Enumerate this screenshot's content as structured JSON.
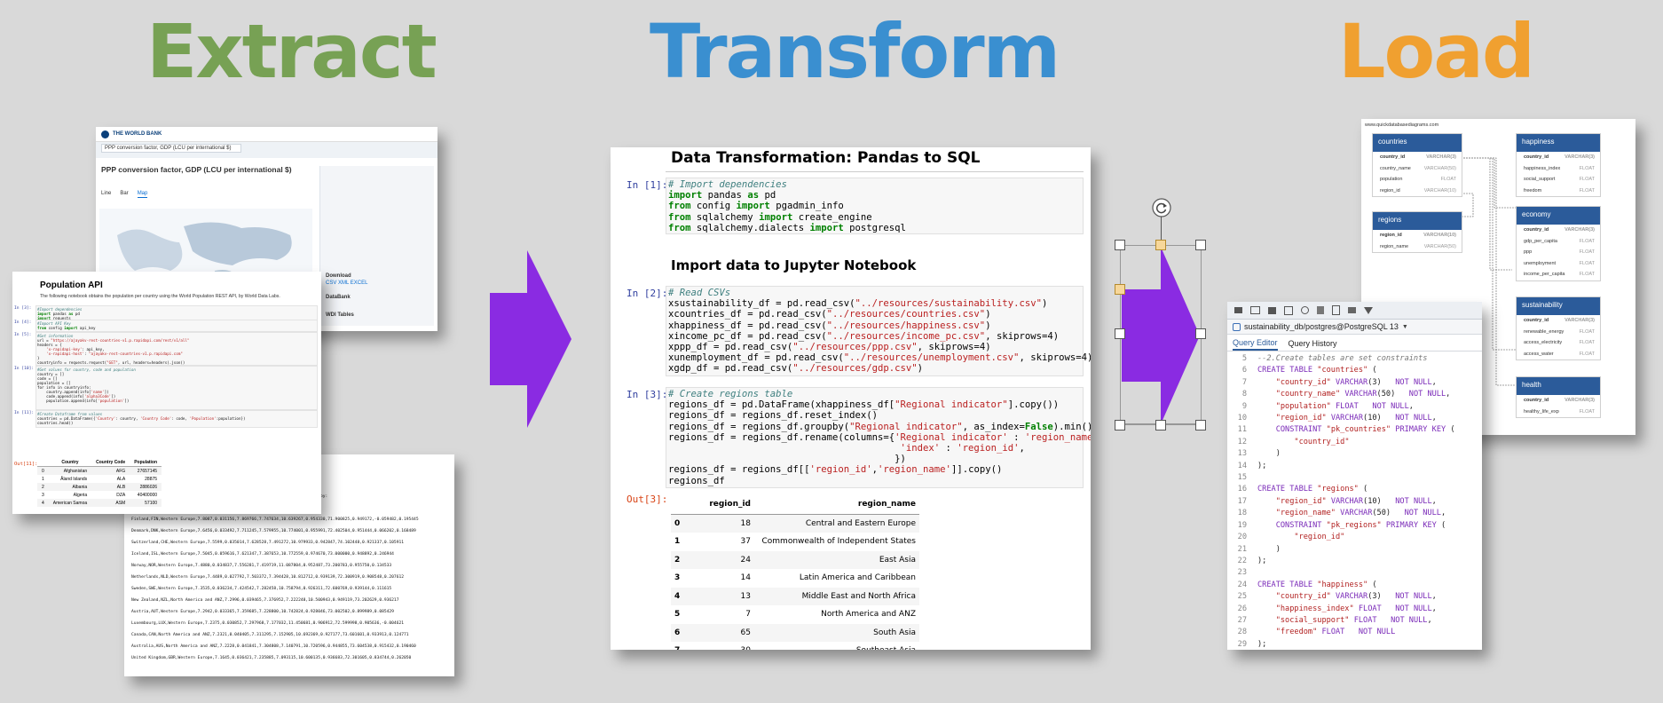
{
  "titles": {
    "extract": "Extract",
    "transform": "Transform",
    "load": "Load"
  },
  "colors": {
    "extract": "#77a154",
    "transform": "#3a8fd0",
    "load": "#f0a030",
    "arrow": "#8a2be2"
  },
  "worldbank": {
    "brand": "THE WORLD BANK",
    "search": "PPP conversion factor, GDP (LCU per international $)",
    "heading": "PPP conversion factor, GDP (LCU per international $)",
    "tabs": [
      "Line",
      "Bar",
      "Map"
    ],
    "sidebar_items": [
      "Download",
      "DataBank",
      "WDI Tables"
    ],
    "sidebar_sub": [
      "CSV  XML  EXCEL"
    ]
  },
  "population_api": {
    "title": "Population API",
    "description": "The following notebook obtains the population per country using the World Population REST API, by World Data Labs.",
    "cells": [
      {
        "prompt": "In [3]:",
        "code": "#Import dependencies\nimport pandas as pd\nimport requests"
      },
      {
        "prompt": "In [4]:",
        "code": "#Import API Key\nfrom config import api_key"
      },
      {
        "prompt": "In [5]:",
        "code": "#Get information\nurl = \"https://ajayakv-rest-countries-v1.p.rapidapi.com/rest/v1/all\"\nheaders = {\n    'x-rapidapi-key': api_key,\n    'x-rapidapi-host': \"ajayakv-rest-countries-v1.p.rapidapi.com\"\n}\ncountryinfo = requests.request(\"GET\", url, headers=headers).json()"
      },
      {
        "prompt": "In [10]:",
        "code": "#Get values for country, code and population\ncountry = []\ncode = []\npopulation = []\nfor info in countryinfo:\n    country.append(info['name'])\n    code.append(info['alpha3Code'])\n    population.append(info['population'])"
      },
      {
        "prompt": "In [11]:",
        "code": "#Create Dataframe from values\ncountries = pd.DataFrame({'Country': country, 'Country Code': code, 'Population':population})\ncountries.head()"
      }
    ],
    "out_prompt": "Out[11]:",
    "table_headers": [
      "",
      "Country",
      "Country Code",
      "Population"
    ],
    "table_rows": [
      [
        "0",
        "Afghanistan",
        "AFG",
        "27657145"
      ],
      [
        "1",
        "Åland Islands",
        "ALA",
        "28875"
      ],
      [
        "2",
        "Albania",
        "ALB",
        "2886026"
      ],
      [
        "3",
        "Algeria",
        "DZA",
        "40400000"
      ],
      [
        "4",
        "American Samoa",
        "ASM",
        "57100"
      ]
    ]
  },
  "csv_excerpt": {
    "lines": [
      "Happiness,Healthy life expectancy,Freedom to make life",
      "choices,Generosity,Perceptions of corruption,Ladder score",
      "Explained by: Log GDP per capita,Explained by:",
      "Healthy life expectancy,Explained by: Freedom to make life choices,Explained by:",
      "Generosity,Dystopia + residual",
      "Finland,FIN,Western Europe,7.8087,0.031156,7.869766,7.747634,10.639267,0.954330,71.900825,0.949172,-0.059482,0.195445",
      "Denmark,DNK,Western Europe,7.6456,0.033492,7.711245,7.579955,10.774001,0.955991,72.402504,0.951444,0.066202,0.168489",
      "Switzerland,CHE,Western Europe,7.5599,0.035014,7.628528,7.491272,10.979933,0.942847,74.102448,0.921337,0.105911",
      "Iceland,ISL,Western Europe,7.5045,0.059616,7.621347,7.387653,10.772559,0.974670,73.000000,0.948892,0.246944",
      "Norway,NOR,Western Europe,7.4880,0.034837,7.556281,7.419719,11.087804,0.952487,73.200783,0.955750,0.134533",
      "Netherlands,NLD,Western Europe,7.4489,0.027792,7.503372,7.394428,10.812712,0.939139,72.300919,0.908548,0.207612",
      "Sweden,SWE,Western Europe,7.3535,0.036234,7.424542,7.282458,10.758794,0.926311,72.600769,0.939144,0.111615",
      "New Zealand,NZL,North America and ANZ,7.2996,0.039465,7.376952,7.222248,10.500943,0.949119,73.202629,0.936217",
      "Austria,AUT,Western Europe,7.2942,0.033365,7.359685,7.228800,10.742824,0.928046,73.002502,0.899989,0.085429",
      "Luxembourg,LUX,Western Europe,7.2375,0.030852,7.297968,7.177032,11.450681,0.906912,72.599998,0.905636,-0.004621",
      "Canada,CAN,North America and ANZ,7.2321,0.040405,7.311295,7.152905,10.692369,0.927177,73.601601,0.933913,0.124771",
      "Australia,AUS,North America and ANZ,7.2228,0.041841,7.304808,7.140791,10.720596,0.944855,73.604538,0.915432,0.190460",
      "United Kingdom,GBR,Western Europe,7.1645,0.036421,7.235885,7.093115,10.600135,0.936683,72.301605,0.834744,0.262050"
    ]
  },
  "notebook": {
    "title": "Data Transformation: Pandas to SQL",
    "section": "Import data to Jupyter Notebook",
    "cells": [
      {
        "prompt": "In [1]:",
        "lines": [
          "# Import dependencies",
          "import pandas as pd",
          "from config import pgadmin_info",
          "from sqlalchemy import create_engine",
          "from sqlalchemy.dialects import postgresql"
        ]
      },
      {
        "prompt": "In [2]:",
        "lines": [
          "# Read CSVs",
          "xsustainability_df = pd.read_csv(\"../resources/sustainability.csv\")",
          "xcountries_df = pd.read_csv(\"../resources/countries.csv\")",
          "xhappiness_df = pd.read_csv(\"../resources/happiness.csv\")",
          "xincome_pc_df = pd.read_csv(\"../resources/income_pc.csv\", skiprows=4)",
          "xppp_df = pd.read_csv(\"../resources/ppp.csv\", skiprows=4)",
          "xunemployment_df = pd.read_csv(\"../resources/unemployment.csv\", skiprows=4)",
          "xgdp_df = pd.read_csv(\"../resources/gdp.csv\")"
        ]
      },
      {
        "prompt": "In [3]:",
        "lines": [
          "# Create regions table",
          "regions_df = pd.DataFrame(xhappiness_df[\"Regional indicator\"].copy())",
          "regions_df = regions_df.reset_index()",
          "regions_df = regions_df.groupby(\"Regional indicator\", as_index=False).min()",
          "regions_df = regions_df.rename(columns={'Regional indicator' : 'region_name',",
          "                                         'index' : 'region_id',",
          "                                        })",
          "regions_df = regions_df[['region_id','region_name']].copy()",
          "regions_df"
        ]
      }
    ],
    "out_prompt": "Out[3]:",
    "table_headers": [
      "",
      "region_id",
      "region_name"
    ],
    "table_rows": [
      [
        "0",
        "18",
        "Central and Eastern Europe"
      ],
      [
        "1",
        "37",
        "Commonwealth of Independent States"
      ],
      [
        "2",
        "24",
        "East Asia"
      ],
      [
        "3",
        "14",
        "Latin America and Caribbean"
      ],
      [
        "4",
        "13",
        "Middle East and North Africa"
      ],
      [
        "5",
        "7",
        "North America and ANZ"
      ],
      [
        "6",
        "65",
        "South Asia"
      ],
      [
        "7",
        "30",
        "Southeast Asia"
      ]
    ]
  },
  "erd": {
    "site": "www.quickdatabasediagrams.com",
    "entities": [
      {
        "name": "countries",
        "rows": [
          [
            "country_id",
            "VARCHAR(3)"
          ],
          [
            "country_name",
            "VARCHAR(50)"
          ],
          [
            "population",
            "FLOAT"
          ],
          [
            "region_id",
            "VARCHAR(10)"
          ]
        ]
      },
      {
        "name": "regions",
        "rows": [
          [
            "region_id",
            "VARCHAR(10)"
          ],
          [
            "region_name",
            "VARCHAR(50)"
          ]
        ]
      },
      {
        "name": "happiness",
        "rows": [
          [
            "country_id",
            "VARCHAR(3)"
          ],
          [
            "happiness_index",
            "FLOAT"
          ],
          [
            "social_support",
            "FLOAT"
          ],
          [
            "freedom",
            "FLOAT"
          ]
        ]
      },
      {
        "name": "economy",
        "rows": [
          [
            "country_id",
            "VARCHAR(3)"
          ],
          [
            "gdp_per_capita",
            "FLOAT"
          ],
          [
            "ppp",
            "FLOAT"
          ],
          [
            "unemployment",
            "FLOAT"
          ],
          [
            "income_per_capita",
            "FLOAT"
          ]
        ]
      },
      {
        "name": "sustainability",
        "rows": [
          [
            "country_id",
            "VARCHAR(3)"
          ],
          [
            "renewable_energy",
            "FLOAT"
          ],
          [
            "access_electricity",
            "FLOAT"
          ],
          [
            "access_water",
            "FLOAT"
          ]
        ]
      },
      {
        "name": "health",
        "rows": [
          [
            "country_id",
            "VARCHAR(3)"
          ],
          [
            "healthy_life_exp",
            "FLOAT"
          ]
        ]
      }
    ]
  },
  "pgadmin": {
    "connection": "sustainability_db/postgres@PostgreSQL 13",
    "tabs": [
      "Query Editor",
      "Query History"
    ],
    "lines": [
      {
        "n": "5",
        "t": "--2.Create tables are set constraints"
      },
      {
        "n": "6",
        "t": "CREATE TABLE \"countries\" ("
      },
      {
        "n": "7",
        "t": "    \"country_id\" VARCHAR(3)   NOT NULL,"
      },
      {
        "n": "8",
        "t": "    \"country_name\" VARCHAR(50)   NOT NULL,"
      },
      {
        "n": "9",
        "t": "    \"population\" FLOAT   NOT NULL,"
      },
      {
        "n": "10",
        "t": "    \"region_id\" VARCHAR(10)   NOT NULL,"
      },
      {
        "n": "11",
        "t": "    CONSTRAINT \"pk_countries\" PRIMARY KEY ("
      },
      {
        "n": "12",
        "t": "        \"country_id\""
      },
      {
        "n": "13",
        "t": "    )"
      },
      {
        "n": "14",
        "t": ");"
      },
      {
        "n": "15",
        "t": ""
      },
      {
        "n": "16",
        "t": "CREATE TABLE \"regions\" ("
      },
      {
        "n": "17",
        "t": "    \"region_id\" VARCHAR(10)   NOT NULL,"
      },
      {
        "n": "18",
        "t": "    \"region_name\" VARCHAR(50)   NOT NULL,"
      },
      {
        "n": "19",
        "t": "    CONSTRAINT \"pk_regions\" PRIMARY KEY ("
      },
      {
        "n": "20",
        "t": "        \"region_id\""
      },
      {
        "n": "21",
        "t": "    )"
      },
      {
        "n": "22",
        "t": ");"
      },
      {
        "n": "23",
        "t": ""
      },
      {
        "n": "24",
        "t": "CREATE TABLE \"happiness\" ("
      },
      {
        "n": "25",
        "t": "    \"country_id\" VARCHAR(3)   NOT NULL,"
      },
      {
        "n": "26",
        "t": "    \"happiness_index\" FLOAT   NOT NULL,"
      },
      {
        "n": "27",
        "t": "    \"social_support\" FLOAT   NOT NULL,"
      },
      {
        "n": "28",
        "t": "    \"freedom\" FLOAT   NOT NULL"
      },
      {
        "n": "29",
        "t": ");"
      }
    ]
  }
}
